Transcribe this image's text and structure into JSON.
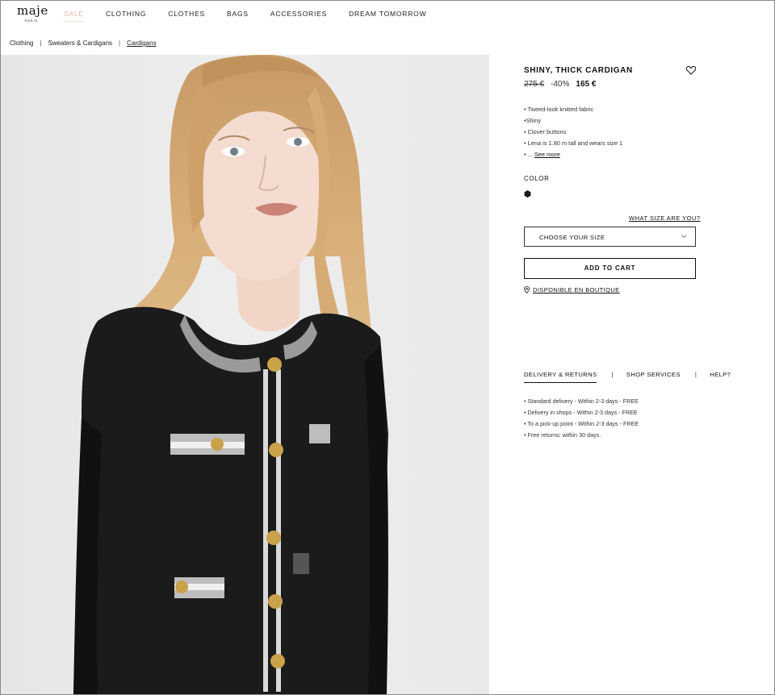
{
  "brand": {
    "logo": "maje",
    "logo_sub": "PARIS"
  },
  "nav": {
    "items": [
      {
        "label": "SALE"
      },
      {
        "label": "CLOTHING"
      },
      {
        "label": "CLOTHES"
      },
      {
        "label": "BAGS"
      },
      {
        "label": "ACCESSORIES"
      },
      {
        "label": "DREAM TOMORROW"
      }
    ]
  },
  "breadcrumb": {
    "items": [
      "Clothing",
      "Sweaters & Cardigans",
      "Cardigans"
    ],
    "separator": "|"
  },
  "product": {
    "title": "SHINY, THICK CARDIGAN",
    "old_price": "275 €",
    "discount": "-40%",
    "price": "165 €",
    "features": [
      "• Tweed-look knitted fabric",
      "•Shiny",
      "• Clover buttons",
      "• Lena is 1.80 m tall and wears size 1",
      "• ... "
    ],
    "see_more": "See more",
    "color_label": "COLOR",
    "swatch_color": "#1a1a1a",
    "size_guide": "WHAT SIZE ARE YOU?",
    "size_placeholder": "CHOOSE YOUR SIZE",
    "add_to_cart": "ADD TO CART",
    "boutique": "DISPONIBLE EN BOUTIQUE"
  },
  "info_tabs": {
    "items": [
      "DELIVERY & RETURNS",
      "SHOP SERVICES",
      "HELP?"
    ],
    "separator": "|"
  },
  "delivery": {
    "lines": [
      "• Standard delivery - Within 2-3 days - FREE",
      "• Delivery in shops - Within 2-3 days - FREE",
      "• To a pick-up point - Within 2-3 days - FREE",
      "• Free returns: within 30 days."
    ]
  },
  "colors": {
    "sale": "#e8b9a5",
    "text": "#111111",
    "image_bg": "#ebebeb"
  }
}
